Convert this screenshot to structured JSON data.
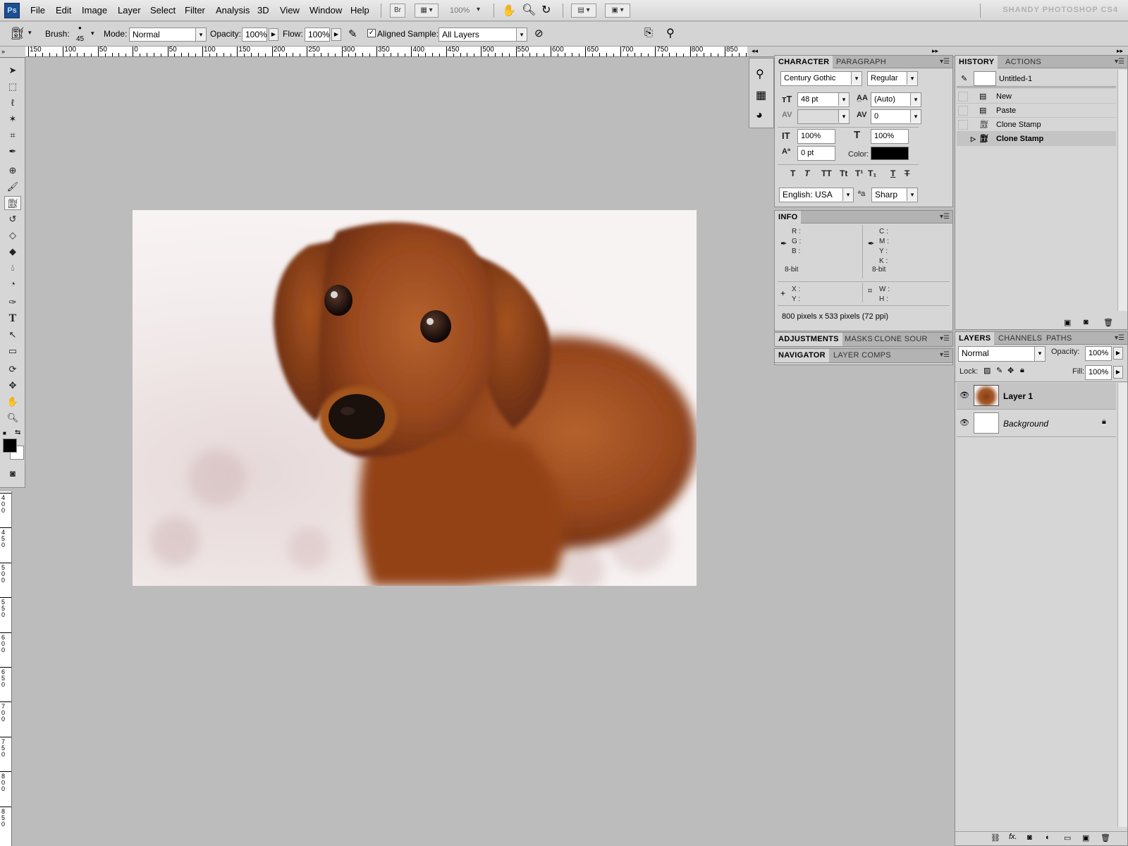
{
  "app": {
    "logo": "Ps",
    "title": "SHANDY PHOTOSHOP CS4"
  },
  "menu": [
    "File",
    "Edit",
    "Image",
    "Layer",
    "Select",
    "Filter",
    "Analysis",
    "3D",
    "View",
    "Window",
    "Help"
  ],
  "menubar": {
    "bridge_label": "Br",
    "zoom": "100%"
  },
  "options": {
    "brush_label": "Brush:",
    "brush_size": "45",
    "mode_label": "Mode:",
    "mode_value": "Normal",
    "opacity_label": "Opacity:",
    "opacity_value": "100%",
    "flow_label": "Flow:",
    "flow_value": "100%",
    "aligned_label": "Aligned",
    "sample_label": "Sample:",
    "sample_value": "All Layers"
  },
  "ruler": {
    "h_labels": [
      "150",
      "100",
      "50",
      "0",
      "50",
      "100",
      "150",
      "200",
      "250",
      "300",
      "350",
      "400",
      "450",
      "500",
      "550",
      "600",
      "650",
      "700",
      "750",
      "800",
      "850"
    ],
    "v_labels": [
      "400",
      "450",
      "500",
      "550",
      "600",
      "650",
      "700",
      "750",
      "800",
      "850"
    ]
  },
  "document": {
    "image_alt": "dachshund puppy photo"
  },
  "character": {
    "tabs": [
      "CHARACTER",
      "PARAGRAPH"
    ],
    "font_family": "Century Gothic",
    "font_style": "Regular",
    "size": "48 pt",
    "leading": "(Auto)",
    "kerning": "",
    "tracking": "0",
    "vscale": "100%",
    "hscale": "100%",
    "baseline": "0 pt",
    "color_label": "Color:",
    "color": "#000000",
    "style_buttons": [
      "T",
      "T",
      "TT",
      "Tt",
      "T¹",
      "T₁",
      "T",
      "T"
    ],
    "language": "English: USA",
    "aa_label": "ªa",
    "antialias": "Sharp"
  },
  "info": {
    "tab": "INFO",
    "rgb": [
      "R :",
      "G :",
      "B :"
    ],
    "cmyk": [
      "C :",
      "M :",
      "Y :",
      "K :"
    ],
    "bit_left": "8-bit",
    "bit_right": "8-bit",
    "xy": [
      "X :",
      "Y :"
    ],
    "wh": [
      "W :",
      "H :"
    ],
    "doc_size": "800 pixels x 533 pixels (72 ppi)"
  },
  "adjust_tabs": [
    "ADJUSTMENTS",
    "MASKS",
    "CLONE SOUR"
  ],
  "nav_tabs": [
    "NAVIGATOR",
    "LAYER COMPS"
  ],
  "history": {
    "tabs": [
      "HISTORY",
      "ACTIONS"
    ],
    "snapshot": "Untitled-1",
    "states": [
      "New",
      "Paste",
      "Clone Stamp",
      "Clone Stamp"
    ],
    "active_index": 3
  },
  "layers": {
    "tabs": [
      "LAYERS",
      "CHANNELS",
      "PATHS"
    ],
    "blend": "Normal",
    "opacity_label": "Opacity:",
    "opacity": "100%",
    "lock_label": "Lock:",
    "fill_label": "Fill:",
    "fill": "100%",
    "items": [
      {
        "name": "Layer 1",
        "active": true
      },
      {
        "name": "Background",
        "active": false
      }
    ]
  }
}
